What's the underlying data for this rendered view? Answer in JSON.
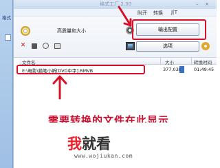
{
  "left_strip": {
    "tab_label": "格式"
  },
  "window": {
    "title": "格式工厂 2.30",
    "menus": [
      "附开",
      "转换",
      "J[T"
    ]
  },
  "controls": {
    "quality_label": "高质量和大小",
    "output_button": "输出配置",
    "option_button": "选项"
  },
  "file_list": {
    "columns": [
      "文件名",
      "大小",
      "转换时间"
    ],
    "rows": [
      {
        "name": "E:\\电影\\蜡笔小新[DVD中字].RMVB",
        "size": "377.03M",
        "duration": "01:49:45"
      }
    ]
  },
  "annotation": {
    "caption": "需要转换的文件在此显示",
    "color": "#d8102a"
  },
  "watermark": {
    "logo_first": "我",
    "logo_rest": "就看",
    "url": "www.wojiukan.com"
  }
}
